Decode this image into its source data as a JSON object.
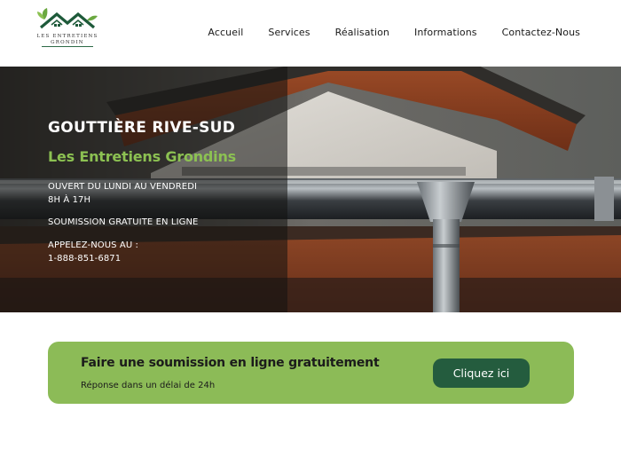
{
  "brand": {
    "logo_text_line1": "LES ENTRETIENS",
    "logo_text_line2": "GRONDIN",
    "primary_green": "#8cc152",
    "dark_green": "#245c3e"
  },
  "nav": {
    "items": [
      {
        "label": "Accueil"
      },
      {
        "label": "Services"
      },
      {
        "label": "Réalisation"
      },
      {
        "label": "Informations"
      },
      {
        "label": "Contactez-Nous"
      }
    ]
  },
  "hero": {
    "title": "GOUTTIÈRE RIVE-SUD",
    "subtitle": "Les Entretiens Grondins",
    "hours_line1": "OUVERT DU LUNDI AU VENDREDI",
    "hours_line2": "8H À 17H",
    "quote_line": "SOUMISSION GRATUITE EN LIGNE",
    "call_label": "APPELEZ-NOUS AU :",
    "phone": "1-888-851-6871"
  },
  "cta": {
    "title": "Faire une soumission en ligne gratuitement",
    "description": "Réponse dans un délai de 24h",
    "button_label": "Cliquez ici"
  }
}
